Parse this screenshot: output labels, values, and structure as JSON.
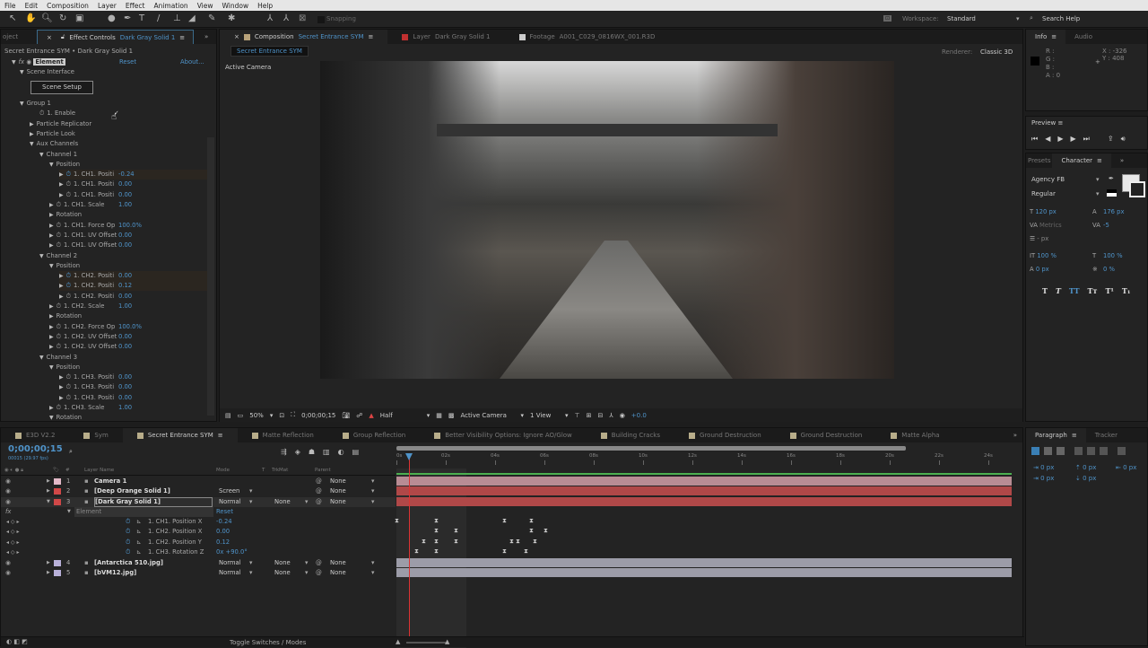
{
  "menu": [
    "File",
    "Edit",
    "Composition",
    "Layer",
    "Effect",
    "Animation",
    "View",
    "Window",
    "Help"
  ],
  "toolbar": {
    "snapping": "Snapping",
    "workspace_label": "Workspace:",
    "workspace": "Standard",
    "search_help": "Search Help"
  },
  "effect_panel": {
    "tab_project": "oject",
    "tab_title": "Effect Controls",
    "tab_layer": "Dark Gray Solid 1",
    "breadcrumb": "Secret Entrance SYM • Dark Gray Solid 1",
    "effect_name": "Element",
    "reset": "Reset",
    "about": "About...",
    "scene_setup": "Scene Setup",
    "rows": [
      {
        "label": "Scene Interface",
        "depth": 1,
        "twirl": "open"
      },
      {
        "label": "Group 1",
        "depth": 1,
        "twirl": "open",
        "gap": true
      },
      {
        "label": "1. Enable",
        "depth": 3,
        "stopwatch": true,
        "value": "✓"
      },
      {
        "label": "Particle Replicator",
        "depth": 2,
        "twirl": "closed"
      },
      {
        "label": "Particle Look",
        "depth": 2,
        "twirl": "closed"
      },
      {
        "label": "Aux Channels",
        "depth": 2,
        "twirl": "open"
      },
      {
        "label": "Channel 1",
        "depth": 3,
        "twirl": "open"
      },
      {
        "label": "Position",
        "depth": 4,
        "twirl": "open"
      },
      {
        "label": "1. CH1. Positi",
        "depth": 5,
        "twirl": "closed",
        "stopwatch": true,
        "active": true,
        "value": "-0.24"
      },
      {
        "label": "1. CH1. Positi",
        "depth": 5,
        "twirl": "closed",
        "stopwatch": true,
        "value": "0.00"
      },
      {
        "label": "1. CH1. Positi",
        "depth": 5,
        "twirl": "closed",
        "stopwatch": true,
        "value": "0.00"
      },
      {
        "label": "1. CH1. Scale",
        "depth": 4,
        "twirl": "closed",
        "stopwatch": true,
        "value": "1.00"
      },
      {
        "label": "Rotation",
        "depth": 4,
        "twirl": "closed"
      },
      {
        "label": "1. CH1. Force Op",
        "depth": 4,
        "twirl": "closed",
        "stopwatch": true,
        "value": "100.0%"
      },
      {
        "label": "1. CH1. UV Offset",
        "depth": 4,
        "twirl": "closed",
        "stopwatch": true,
        "value": "0.00"
      },
      {
        "label": "1. CH1. UV Offset",
        "depth": 4,
        "twirl": "closed",
        "stopwatch": true,
        "value": "0.00"
      },
      {
        "label": "Channel 2",
        "depth": 3,
        "twirl": "open"
      },
      {
        "label": "Position",
        "depth": 4,
        "twirl": "open"
      },
      {
        "label": "1. CH2. Positi",
        "depth": 5,
        "twirl": "closed",
        "stopwatch": true,
        "active": true,
        "value": "0.00"
      },
      {
        "label": "1. CH2. Positi",
        "depth": 5,
        "twirl": "closed",
        "stopwatch": true,
        "active": true,
        "value": "0.12"
      },
      {
        "label": "1. CH2. Positi",
        "depth": 5,
        "twirl": "closed",
        "stopwatch": true,
        "value": "0.00"
      },
      {
        "label": "1. CH2. Scale",
        "depth": 4,
        "twirl": "closed",
        "stopwatch": true,
        "value": "1.00"
      },
      {
        "label": "Rotation",
        "depth": 4,
        "twirl": "closed"
      },
      {
        "label": "1. CH2. Force Op",
        "depth": 4,
        "twirl": "closed",
        "stopwatch": true,
        "value": "100.0%"
      },
      {
        "label": "1. CH2. UV Offset",
        "depth": 4,
        "twirl": "closed",
        "stopwatch": true,
        "value": "0.00"
      },
      {
        "label": "1. CH2. UV Offset",
        "depth": 4,
        "twirl": "closed",
        "stopwatch": true,
        "value": "0.00"
      },
      {
        "label": "Channel 3",
        "depth": 3,
        "twirl": "open"
      },
      {
        "label": "Position",
        "depth": 4,
        "twirl": "open"
      },
      {
        "label": "1. CH3. Positi",
        "depth": 5,
        "twirl": "closed",
        "stopwatch": true,
        "value": "0.00"
      },
      {
        "label": "1. CH3. Positi",
        "depth": 5,
        "twirl": "closed",
        "stopwatch": true,
        "value": "0.00"
      },
      {
        "label": "1. CH3. Positi",
        "depth": 5,
        "twirl": "closed",
        "stopwatch": true,
        "value": "0.00"
      },
      {
        "label": "1. CH3. Scale",
        "depth": 4,
        "twirl": "closed",
        "stopwatch": true,
        "value": "1.00"
      },
      {
        "label": "Rotation",
        "depth": 4,
        "twirl": "open"
      }
    ]
  },
  "comp_panel": {
    "tabs": [
      {
        "prefix": "Composition",
        "name": "Secret Entrance SYM",
        "color": "#b8a27a"
      },
      {
        "prefix": "Layer",
        "name": "Dark Gray Solid 1",
        "color": "#c03030"
      },
      {
        "prefix": "Footage",
        "name": "A001_C029_0816WX_001.R3D",
        "color": "#cccccc"
      }
    ],
    "subtab": "Secret Entrance SYM",
    "renderer_label": "Renderer:",
    "renderer": "Classic 3D",
    "view_label": "Active Camera",
    "footer": {
      "zoom": "50%",
      "timecode": "0;00;00;15",
      "resolution": "Half",
      "camera": "Active Camera",
      "views": "1 View",
      "exposure": "+0.0"
    }
  },
  "info": {
    "tab": "Info",
    "tab2": "Audio",
    "r": "R :",
    "g": "G :",
    "b": "B :",
    "a": "A : 0",
    "x": "X : -326",
    "y": "Y : 408"
  },
  "preview": {
    "title": "Preview"
  },
  "character": {
    "tab_prev": "Presets",
    "tab": "Character",
    "font": "Agency FB",
    "style": "Regular",
    "size": "120 px",
    "leading": "176 px",
    "kerning": "Metrics",
    "tracking": "-5",
    "stroke": "- px",
    "vscale": "100 %",
    "hscale": "100 %",
    "baseline": "0 px",
    "tsume": "0 %"
  },
  "paragraph": {
    "tab": "Paragraph",
    "tab2": "Tracker",
    "indent": "0 px"
  },
  "timeline": {
    "tabs": [
      {
        "name": "E3D V2.2"
      },
      {
        "name": "Sym"
      },
      {
        "name": "Secret Entrance SYM",
        "active": true
      },
      {
        "name": "Matte Reflection"
      },
      {
        "name": "Group Reflection"
      },
      {
        "name": "Better Visibility Options: Ignore AO/Glow"
      },
      {
        "name": "Building Cracks"
      },
      {
        "name": "Ground Destruction"
      },
      {
        "name": "Ground Destruction"
      },
      {
        "name": "Matte Alpha"
      }
    ],
    "timecode": "0;00;00;15",
    "fps": "00015 (29.97 fps)",
    "headers": {
      "name": "Layer Name",
      "mode": "Mode",
      "t": "T",
      "trkmat": "TrkMat",
      "parent": "Parent"
    },
    "ruler": [
      "0s",
      "02s",
      "04s",
      "06s",
      "08s",
      "10s",
      "12s",
      "14s",
      "16s",
      "18s",
      "20s",
      "22s",
      "24s"
    ],
    "layers": [
      {
        "num": "1",
        "name": "Camera 1",
        "color": "#e3b9c8",
        "mode": "",
        "trkmat": "",
        "parent": "None",
        "bar": "#b88c94"
      },
      {
        "num": "2",
        "name": "[Deep Orange Solid 1]",
        "color": "#d04848",
        "mode": "Screen",
        "trkmat": "",
        "parent": "None",
        "bar": "#b04848"
      },
      {
        "num": "3",
        "name": "[Dark Gray Solid 1]",
        "color": "#d04848",
        "mode": "Normal",
        "trkmat": "None",
        "parent": "None",
        "bar": "#b04848",
        "selected": true
      }
    ],
    "effect": {
      "name": "Element",
      "reset": "Reset",
      "props": [
        {
          "name": "1. CH1. Position X",
          "value": "-0.24"
        },
        {
          "name": "1. CH2. Position X",
          "value": "0.00"
        },
        {
          "name": "1. CH2. Position Y",
          "value": "0.12"
        },
        {
          "name": "1. CH3. Rotation Z",
          "value": "0x +90.0°"
        }
      ]
    },
    "layers2": [
      {
        "num": "4",
        "name": "[Antarctica 510.jpg]",
        "color": "#b8b0d8",
        "mode": "Normal",
        "trkmat": "None",
        "parent": "None",
        "bar": "#9c9ca8"
      },
      {
        "num": "5",
        "name": "[bVM12.jpg]",
        "color": "#b8b0d8",
        "mode": "Normal",
        "trkmat": "None",
        "parent": "None",
        "bar": "#9c9ca8"
      }
    ],
    "toggle": "Toggle Switches / Modes"
  }
}
